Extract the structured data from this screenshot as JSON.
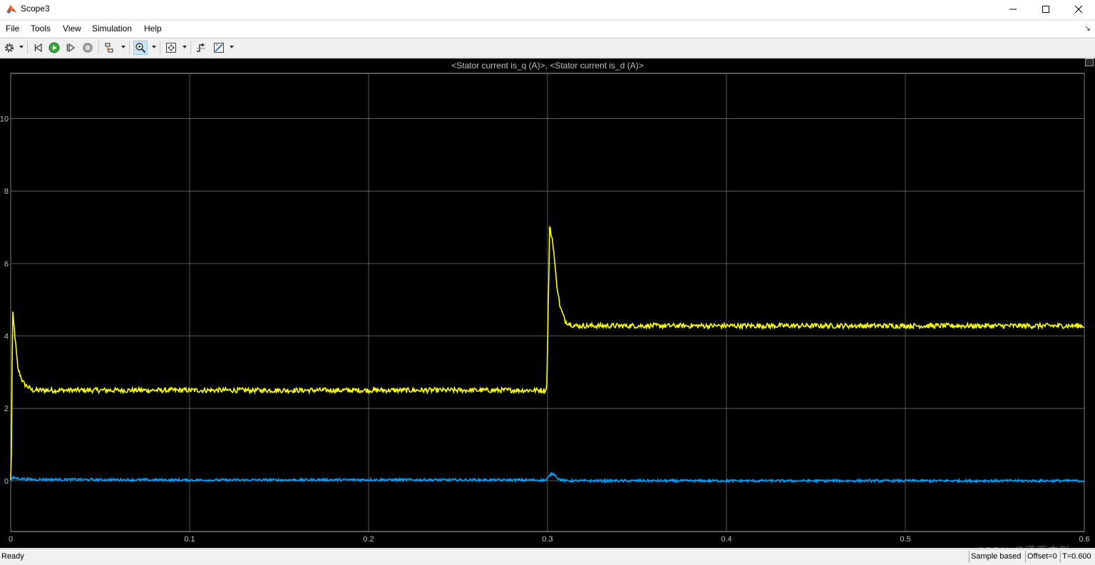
{
  "window": {
    "title": "Scope3"
  },
  "menu": [
    "File",
    "Tools",
    "View",
    "Simulation",
    "Help"
  ],
  "toolbar": [
    {
      "icon": "gear-icon",
      "has_dropdown": true
    },
    {
      "icon": "step-back-icon"
    },
    {
      "icon": "run-icon"
    },
    {
      "icon": "step-forward-icon"
    },
    {
      "icon": "stop-icon"
    },
    {
      "icon": "highlight-signal-icon",
      "has_dropdown": true
    },
    {
      "icon": "zoom-icon",
      "has_dropdown": true,
      "selected": true
    },
    {
      "icon": "fit-to-view-icon",
      "has_dropdown": true
    },
    {
      "icon": "triggers-icon"
    },
    {
      "icon": "measure-icon",
      "has_dropdown": true
    }
  ],
  "scope": {
    "title": "<Stator current is_q (A)>, <Stator current is_d (A)>"
  },
  "chart_data": {
    "type": "line",
    "title": "<Stator current is_q (A)>, <Stator current is_d (A)>",
    "xlabel": "",
    "ylabel": "",
    "xlim": [
      0,
      0.6
    ],
    "ylim": [
      -1.4,
      11.25
    ],
    "x_ticks": [
      "0",
      "0.1",
      "0.2",
      "0.3",
      "0.4",
      "0.5",
      "0.6"
    ],
    "y_ticks": [
      "0",
      "2",
      "4",
      "6",
      "8",
      "10"
    ],
    "grid": true,
    "background": "#000000",
    "series": [
      {
        "color": "#ffff00",
        "noise": 0.07,
        "points": [
          [
            0,
            0
          ],
          [
            0.0005,
            1.0
          ],
          [
            0.001,
            4.7
          ],
          [
            0.002,
            4.2
          ],
          [
            0.004,
            3.1
          ],
          [
            0.007,
            2.7
          ],
          [
            0.012,
            2.5
          ],
          [
            0.05,
            2.5
          ],
          [
            0.1,
            2.5
          ],
          [
            0.2,
            2.5
          ],
          [
            0.2995,
            2.5
          ],
          [
            0.3,
            3.6
          ],
          [
            0.3012,
            7.0
          ],
          [
            0.303,
            6.6
          ],
          [
            0.305,
            5.5
          ],
          [
            0.307,
            4.8
          ],
          [
            0.31,
            4.4
          ],
          [
            0.315,
            4.28
          ],
          [
            0.35,
            4.28
          ],
          [
            0.4,
            4.28
          ],
          [
            0.5,
            4.28
          ],
          [
            0.6,
            4.28
          ]
        ]
      },
      {
        "color": "#00a0ff",
        "noise": 0.035,
        "points": [
          [
            0,
            0
          ],
          [
            0.001,
            0.08
          ],
          [
            0.01,
            0.04
          ],
          [
            0.1,
            0.02
          ],
          [
            0.2,
            0.03
          ],
          [
            0.299,
            0.02
          ],
          [
            0.3,
            0.05
          ],
          [
            0.302,
            0.2
          ],
          [
            0.304,
            0.18
          ],
          [
            0.306,
            0.05
          ],
          [
            0.31,
            0.0
          ],
          [
            0.6,
            0.0
          ]
        ]
      }
    ]
  },
  "status": {
    "ready": "Ready",
    "mode": "Sample based",
    "offset": "Offset=0",
    "time": "T=0.600"
  },
  "watermark": "CSDN @潇而去形"
}
